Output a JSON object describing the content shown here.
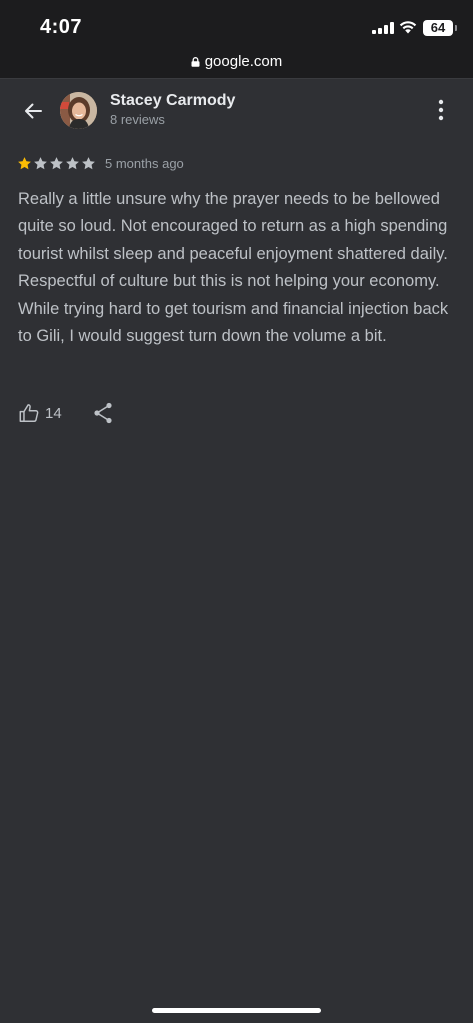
{
  "status_bar": {
    "time": "4:07",
    "battery": "64",
    "icons": [
      "cellular-signal-icon",
      "wifi-icon",
      "battery-icon"
    ]
  },
  "browser": {
    "url": "google.com",
    "icon": "lock-icon"
  },
  "review": {
    "author_name": "Stacey Carmody",
    "author_reviews": "8 reviews",
    "rating": 1,
    "max_rating": 5,
    "date": "5 months ago",
    "text": "Really a little unsure why the prayer needs to be bellowed quite so loud. Not encouraged to return as a high spending tourist whilst sleep and peaceful enjoyment shattered daily. Respectful of culture but this is not helping your economy. While trying hard to get tourism and financial injection back to Gili, I would suggest turn down the volume a bit.",
    "likes": "14"
  },
  "icons": {
    "back": "arrow-back-icon",
    "more": "more-vert-icon",
    "like": "thumb-up-icon",
    "share": "share-icon"
  },
  "colors": {
    "background": "#2f3034",
    "star_filled": "#fbbc04",
    "star_empty": "#bdc1c6",
    "text_primary": "#e8eaed",
    "text_secondary": "#9aa0a6"
  }
}
